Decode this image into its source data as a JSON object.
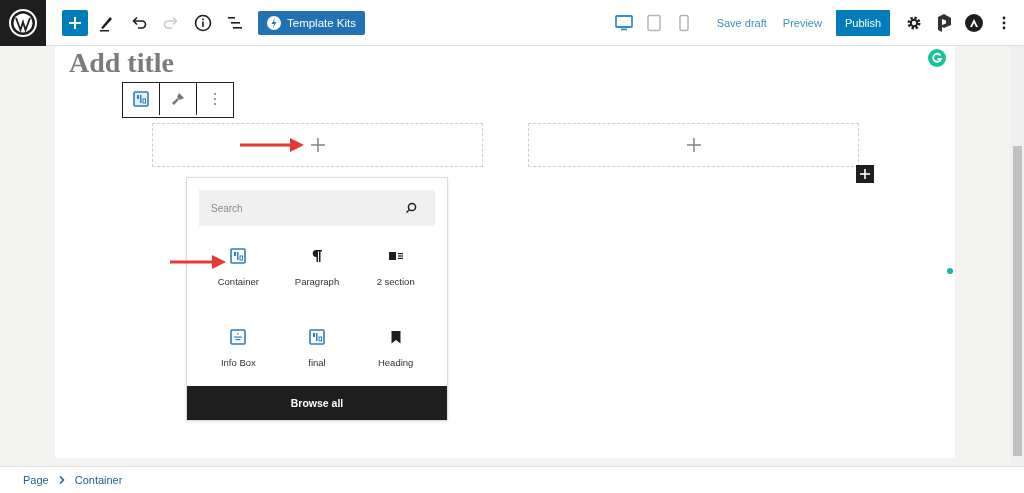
{
  "header": {
    "tools": [
      {
        "kind": "add",
        "disabled": false
      },
      {
        "kind": "pencil",
        "disabled": false
      },
      {
        "kind": "undo",
        "disabled": false
      },
      {
        "kind": "redo",
        "disabled": true
      },
      {
        "kind": "info",
        "disabled": false
      },
      {
        "kind": "list",
        "disabled": false
      }
    ],
    "template_kits": "Template Kits",
    "devices": [
      {
        "kind": "desktop",
        "selected": true
      },
      {
        "kind": "tablet",
        "selected": false
      },
      {
        "kind": "mobile",
        "selected": false
      }
    ],
    "save_draft": "Save draft",
    "preview": "Preview",
    "publish": "Publish"
  },
  "editor": {
    "title": "Add title",
    "columns": [
      {
        "kind": "empty"
      },
      {
        "kind": "empty"
      }
    ]
  },
  "inserter": {
    "placeholder": "Search",
    "blocks": [
      {
        "label": "Container",
        "kind": "container"
      },
      {
        "label": "Paragraph",
        "kind": "paragraph"
      },
      {
        "label": "2 section",
        "kind": "section"
      },
      {
        "label": "Info Box",
        "kind": "infobox"
      },
      {
        "label": "final",
        "kind": "container"
      },
      {
        "label": "Heading",
        "kind": "bookmark"
      }
    ],
    "browse_all": "Browse all"
  },
  "breadcrumb": [
    "Page",
    "Container"
  ]
}
